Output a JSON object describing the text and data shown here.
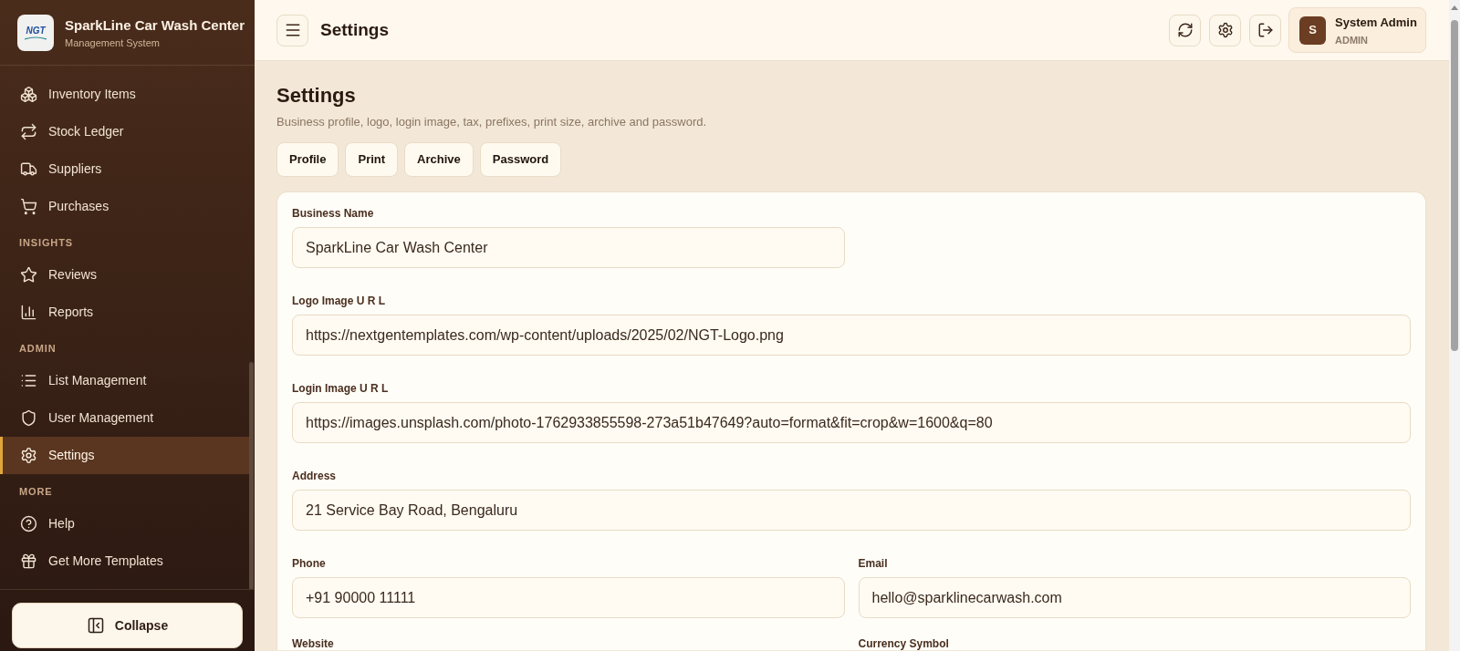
{
  "sidebar": {
    "brand": {
      "logo_text": "NGT",
      "title": "SparkLine Car Wash Center",
      "subtitle": "Management System"
    },
    "sections": [
      {
        "items": [
          {
            "label": "Inventory Items",
            "selected": false
          },
          {
            "label": "Stock Ledger",
            "selected": false
          },
          {
            "label": "Suppliers",
            "selected": false
          },
          {
            "label": "Purchases",
            "selected": false
          }
        ]
      },
      {
        "title": "INSIGHTS",
        "items": [
          {
            "label": "Reviews",
            "selected": false
          },
          {
            "label": "Reports",
            "selected": false
          }
        ]
      },
      {
        "title": "ADMIN",
        "items": [
          {
            "label": "List Management",
            "selected": false
          },
          {
            "label": "User Management",
            "selected": false
          },
          {
            "label": "Settings",
            "selected": true
          }
        ]
      },
      {
        "title": "MORE",
        "items": [
          {
            "label": "Help",
            "selected": false
          },
          {
            "label": "Get More Templates",
            "selected": false
          }
        ]
      }
    ],
    "collapse_button": "Collapse"
  },
  "header": {
    "title": "Settings",
    "user": {
      "initial": "S",
      "name": "System Admin",
      "role": "ADMIN"
    }
  },
  "page": {
    "title": "Settings",
    "subtitle": "Business profile, logo, login image, tax, prefixes, print size, archive and password.",
    "tabs": [
      {
        "label": "Profile"
      },
      {
        "label": "Print"
      },
      {
        "label": "Archive"
      },
      {
        "label": "Password"
      }
    ],
    "fields": [
      {
        "label": "Business Name",
        "value": "SparkLine Car Wash Center"
      },
      {
        "label": "Logo Image U R L",
        "value": "https://nextgentemplates.com/wp-content/uploads/2025/02/NGT-Logo.png"
      },
      {
        "label": "Login Image U R L",
        "value": "https://images.unsplash.com/photo-1762933855598-273a51b47649?auto=format&fit=crop&w=1600&q=80"
      },
      {
        "label": "Address",
        "value": "21 Service Bay Road, Bengaluru"
      },
      {
        "label": "Phone",
        "value": "+91 90000 11111"
      },
      {
        "label": "Email",
        "value": "hello@sparklinecarwash.com"
      },
      {
        "label": "Website"
      },
      {
        "label": "Currency Symbol"
      }
    ]
  }
}
